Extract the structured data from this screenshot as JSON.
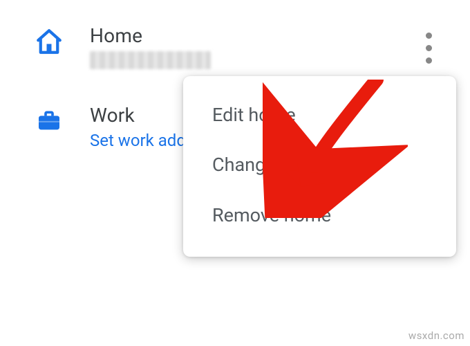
{
  "colors": {
    "accent": "#1a73e8",
    "text": "#3c4043",
    "arrow": "#e81c0d"
  },
  "rows": [
    {
      "icon": "home-icon",
      "title": "Home",
      "subtitle_blurred": true,
      "has_menu": true
    },
    {
      "icon": "briefcase-icon",
      "title": "Work",
      "subtitle_link": "Set work address",
      "has_menu": false
    }
  ],
  "menu": {
    "items": [
      {
        "label": "Edit home"
      },
      {
        "label": "Change icon"
      },
      {
        "label": "Remove home"
      }
    ]
  },
  "watermark": "wsxdn.com"
}
